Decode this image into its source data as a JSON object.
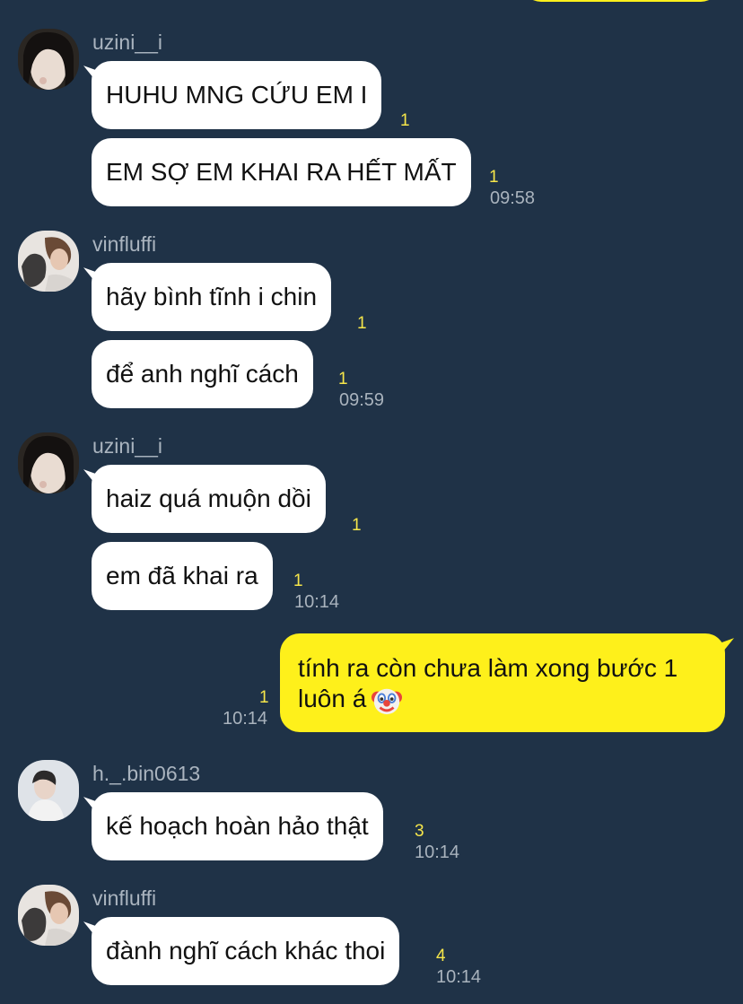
{
  "colors": {
    "background": "#1f3247",
    "incoming_bubble": "#ffffff",
    "outgoing_bubble": "#fef01b",
    "unread_count": "#f6e64a",
    "timestamp": "#a9b3bd"
  },
  "messages": {
    "g1": {
      "sender": "uzini__i",
      "m1": {
        "text": "HUHU MNG CỨU EM I",
        "unread": "1"
      },
      "m2": {
        "text": "EM SỢ EM KHAI RA HẾT MẤT",
        "unread": "1",
        "time": "09:58"
      }
    },
    "g2": {
      "sender": "vinfluffi",
      "m1": {
        "text": "hãy bình tĩnh i chin",
        "unread": "1"
      },
      "m2": {
        "text": "để anh nghĩ cách",
        "unread": "1",
        "time": "09:59"
      }
    },
    "g3": {
      "sender": "uzini__i",
      "m1": {
        "text": "haiz quá muộn dồi",
        "unread": "1"
      },
      "m2": {
        "text": "em đã khai ra",
        "unread": "1",
        "time": "10:14"
      }
    },
    "mine": {
      "line1": "tính ra còn chưa làm xong bước 1",
      "line2": "luôn á",
      "emoji": "clown-face-emoji",
      "unread": "1",
      "time": "10:14"
    },
    "g4": {
      "sender": "h._.bin0613",
      "m1": {
        "text": "kế hoạch hoàn hảo thật",
        "unread": "3",
        "time": "10:14"
      }
    },
    "g5": {
      "sender": "vinfluffi",
      "m1": {
        "text": "đành nghĩ cách khác thoi",
        "unread": "4",
        "time": "10:14"
      }
    }
  }
}
